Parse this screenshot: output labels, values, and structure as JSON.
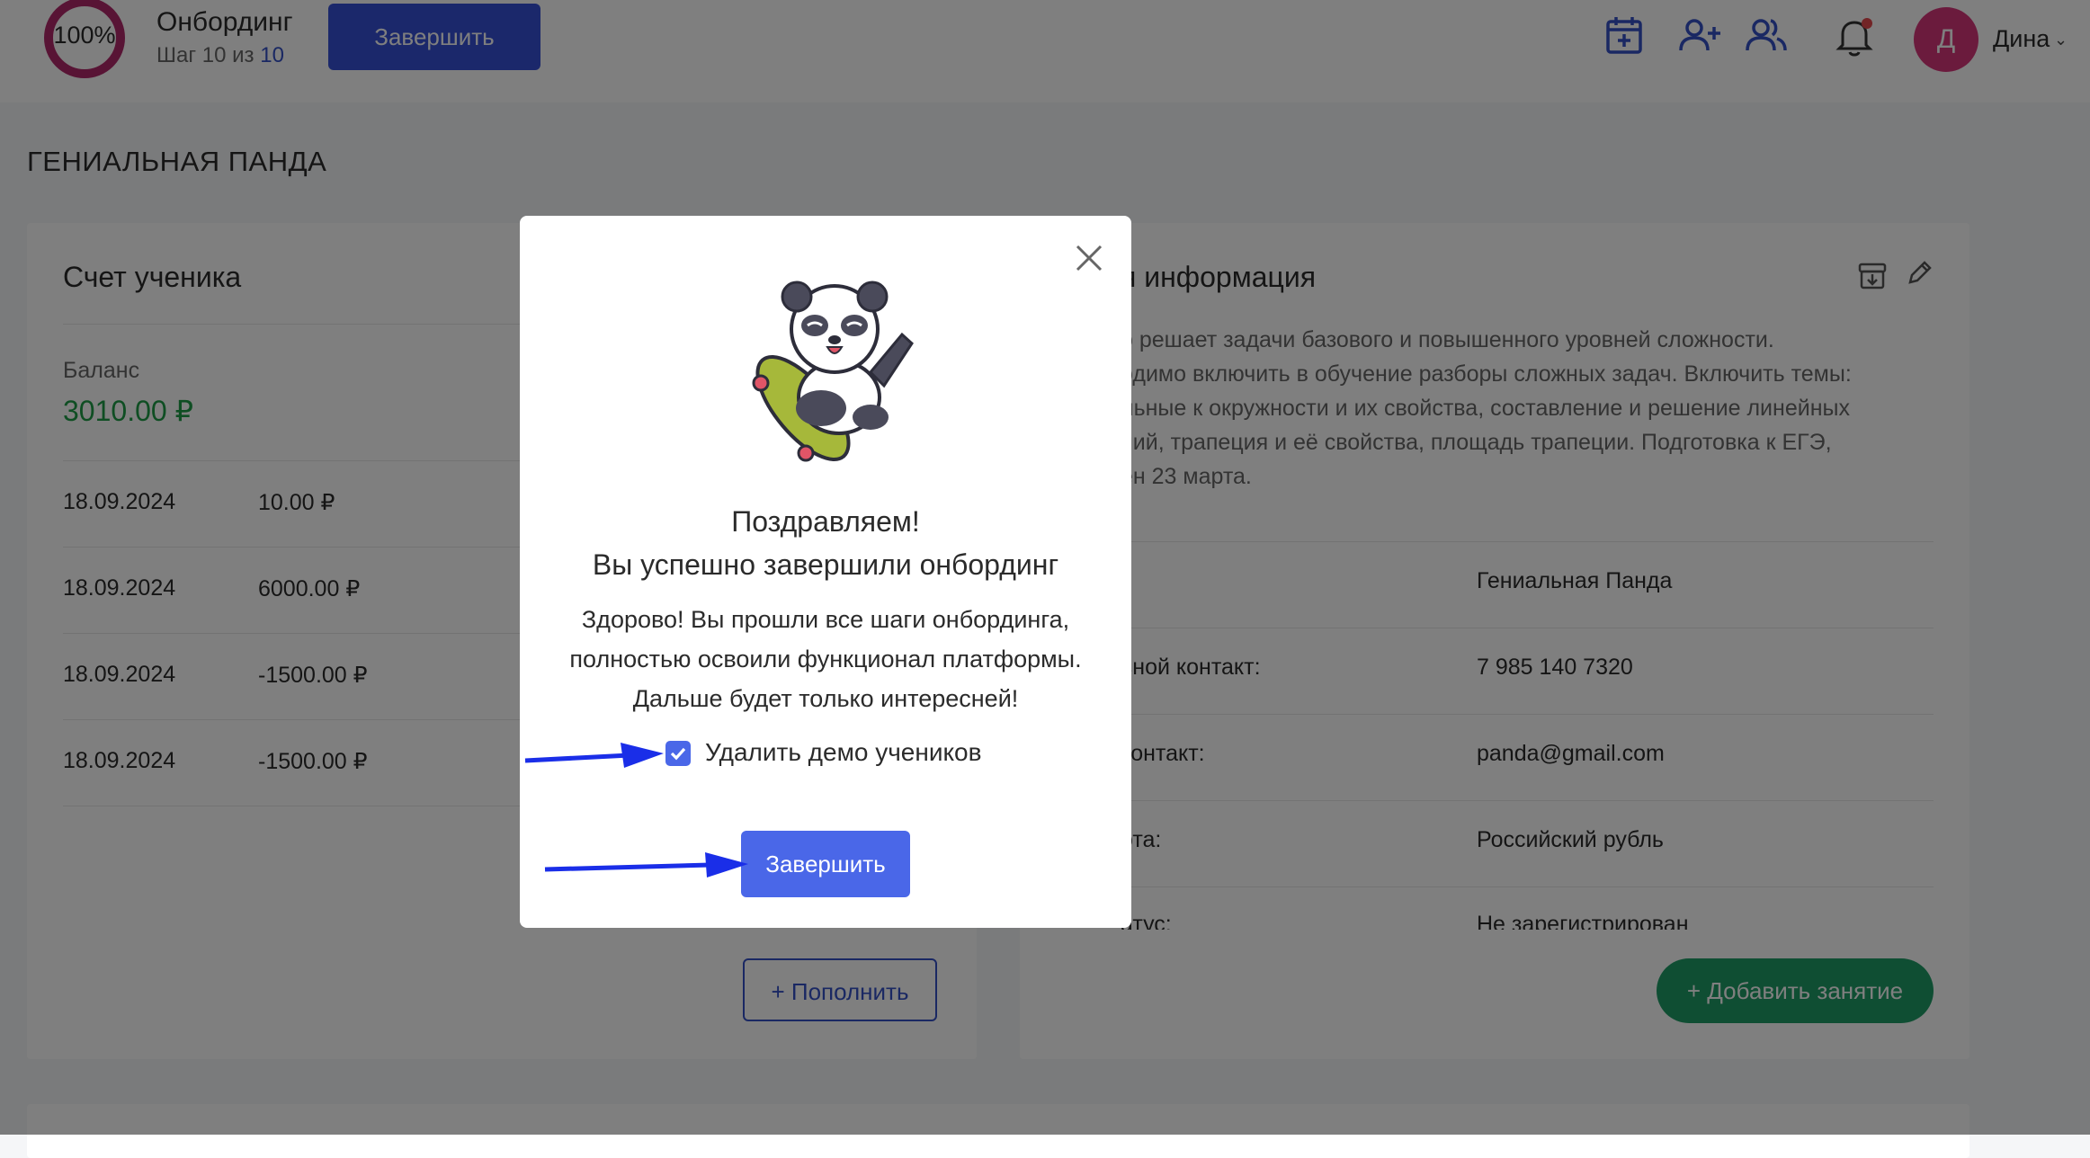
{
  "header": {
    "progress_text": "100%",
    "progress_fraction": 1.0,
    "onboarding_title": "Онбординг",
    "step_prefix": "Шаг 10 из",
    "step_total": "10",
    "finish_button": "Завершить",
    "icons": [
      "calendar-add-icon",
      "add-user-icon",
      "users-icon",
      "bell-icon"
    ],
    "avatar_letter": "Д",
    "user_name": "Дина",
    "notification_dot_color": "#e5484d"
  },
  "page": {
    "title": "ГЕНИАЛЬНАЯ ПАНДА"
  },
  "account": {
    "title": "Счет ученика",
    "balance_label": "Баланс",
    "balance_value": "3010.00 ₽",
    "transactions": [
      {
        "date": "18.09.2024",
        "amount": "10.00 ₽"
      },
      {
        "date": "18.09.2024",
        "amount": "6000.00 ₽"
      },
      {
        "date": "18.09.2024",
        "amount": "-1500.00 ₽"
      },
      {
        "date": "18.09.2024",
        "amount": "-1500.00 ₽"
      }
    ],
    "topup_button": "+ Пополнить"
  },
  "info": {
    "title": "я информация",
    "description_lines": [
      "о решает задачи базового и повышенного уровней сложности.",
      "одимо включить в обучение разборы сложных задач. Включить темы:",
      "льные к окружности и их свойства, составление и решение линейных",
      "ний, трапеция и её свойства, площадь трапеции. Подготовка к ЕГЭ,",
      "ен 23 марта."
    ],
    "rows": [
      {
        "label": "",
        "value": "Гениальная Панда"
      },
      {
        "label": "вной контакт:",
        "value": "7 985 140 7320"
      },
      {
        "label": "контакт:",
        "value": "panda@gmail.com"
      },
      {
        "label": "ота:",
        "value": "Российский рубль"
      },
      {
        "label": "атус:",
        "value": "Не зарегистрирован"
      }
    ],
    "add_lesson_button": "+ Добавить занятие"
  },
  "modal": {
    "title_line_1": "Поздравляем!",
    "title_line_2": "Вы успешно завершили онбординг",
    "body_lines": [
      "Здорово! Вы прошли все шаги онбординга,",
      "полностью освоили функционал платформы.",
      "Дальше будет только интересней!"
    ],
    "checkbox_label": "Удалить демо учеников",
    "checkbox_checked": true,
    "finish_button": "Завершить",
    "accent_color": "#4a67e8"
  },
  "annotations": {
    "arrow_color": "#1a2ee8"
  }
}
